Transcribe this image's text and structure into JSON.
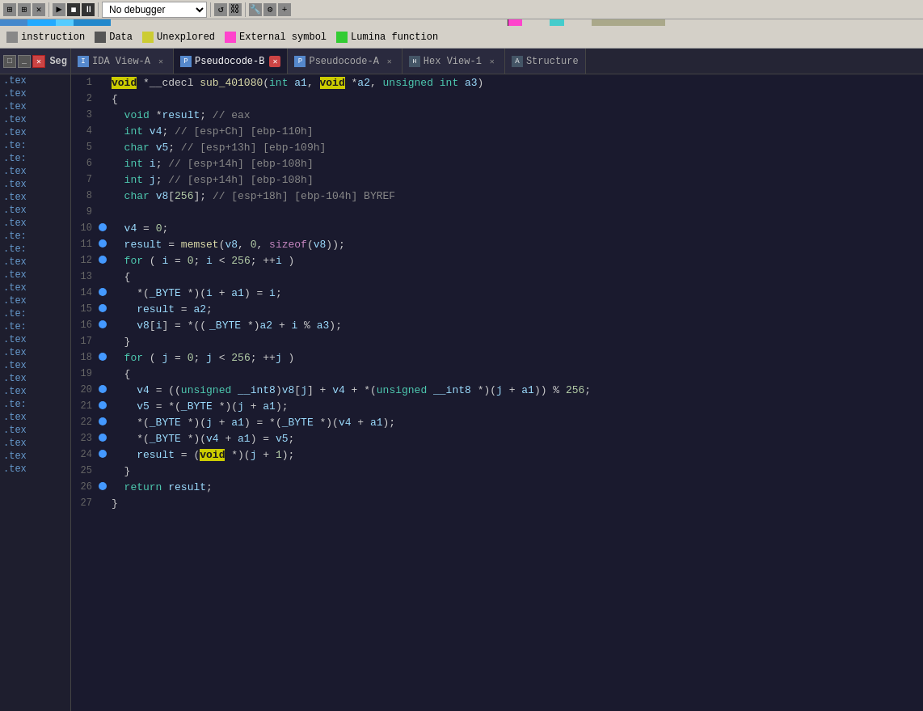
{
  "toolbar": {
    "debugger_label": "No debugger",
    "icons": [
      "grid",
      "grid",
      "cross",
      "play",
      "stop",
      "pause",
      "cursor",
      "cursor2",
      "link",
      "chain",
      "settings",
      "settings2",
      "plus"
    ]
  },
  "colorbar": {
    "segments": [
      {
        "color": "#4488cc",
        "width": "3%"
      },
      {
        "color": "#22aaff",
        "width": "3%"
      },
      {
        "color": "#55ccff",
        "width": "2%"
      },
      {
        "color": "#2288cc",
        "width": "4%"
      },
      {
        "color": "#d4d0c8",
        "width": "45%"
      },
      {
        "color": "#ff44cc",
        "width": "1%"
      },
      {
        "color": "#d4d0c8",
        "width": "3%"
      },
      {
        "color": "#44cccc",
        "width": "1%"
      },
      {
        "color": "#d4d0c8",
        "width": "3%"
      },
      {
        "color": "#aaa88a",
        "width": "6%"
      },
      {
        "color": "#d4d0c8",
        "width": "29%"
      }
    ]
  },
  "legend": {
    "items": [
      {
        "label": "instruction",
        "color": "#aaaaaa"
      },
      {
        "label": "Data",
        "color": "#555555"
      },
      {
        "label": "Unexplored",
        "color": "#cccc33"
      },
      {
        "label": "External symbol",
        "color": "#ff44cc"
      },
      {
        "label": "Lumina function",
        "color": "#33cc33"
      }
    ]
  },
  "sidebar": {
    "title": "Seg",
    "items": [
      ".tex",
      ".tex",
      ".tex",
      ".tex",
      ".tex",
      ".te:",
      ".te:",
      ".tex",
      ".tex",
      ".tex",
      ".tex",
      ".tex",
      ".te:",
      ".te:",
      ".tex",
      ".tex",
      ".tex",
      ".tex",
      ".te:",
      ".te:",
      ".tex",
      ".tex",
      ".tex",
      ".tex",
      ".tex",
      ".te:",
      ".tex",
      ".tex",
      ".tex",
      ".tex",
      ".tex"
    ]
  },
  "tabs": [
    {
      "label": "IDA View-A",
      "active": false,
      "closable": true,
      "icon": "ida"
    },
    {
      "label": "Pseudocode-B",
      "active": true,
      "closable": true,
      "icon": "pseudo",
      "has_x": true
    },
    {
      "label": "Pseudocode-A",
      "active": false,
      "closable": true,
      "icon": "pseudo"
    },
    {
      "label": "Hex View-1",
      "active": false,
      "closable": true,
      "icon": "hex"
    },
    {
      "label": "Structure",
      "active": false,
      "closable": false,
      "icon": "struct"
    }
  ],
  "code": {
    "function_signature": "void *__cdecl sub_401080(int a1, void *a2, unsigned int a3)",
    "lines": [
      {
        "num": 1,
        "bp": false,
        "content": "void *__cdecl sub_401080(int a1, void *a2, unsigned int a3)"
      },
      {
        "num": 2,
        "bp": false,
        "content": "{"
      },
      {
        "num": 3,
        "bp": false,
        "content": "  void *result; // eax"
      },
      {
        "num": 4,
        "bp": false,
        "content": "  int v4; // [esp+Ch] [ebp-110h]"
      },
      {
        "num": 5,
        "bp": false,
        "content": "  char v5; // [esp+13h] [ebp-109h]"
      },
      {
        "num": 6,
        "bp": false,
        "content": "  int i; // [esp+14h] [ebp-108h]"
      },
      {
        "num": 7,
        "bp": false,
        "content": "  int j; // [esp+14h] [ebp-108h]"
      },
      {
        "num": 8,
        "bp": false,
        "content": "  char v8[256]; // [esp+18h] [ebp-104h] BYREF"
      },
      {
        "num": 9,
        "bp": false,
        "content": ""
      },
      {
        "num": 10,
        "bp": true,
        "content": "  v4 = 0;"
      },
      {
        "num": 11,
        "bp": true,
        "content": "  result = memset(v8, 0, sizeof(v8));"
      },
      {
        "num": 12,
        "bp": true,
        "content": "  for ( i = 0; i < 256; ++i )"
      },
      {
        "num": 13,
        "bp": false,
        "content": "  {"
      },
      {
        "num": 14,
        "bp": true,
        "content": "    *(_BYTE *)(i + a1) = i;"
      },
      {
        "num": 15,
        "bp": true,
        "content": "    result = a2;"
      },
      {
        "num": 16,
        "bp": true,
        "content": "    v8[i] = *((_BYTE *)a2 + i % a3);"
      },
      {
        "num": 17,
        "bp": false,
        "content": "  }"
      },
      {
        "num": 18,
        "bp": true,
        "content": "  for ( j = 0; j < 256; ++j )"
      },
      {
        "num": 19,
        "bp": false,
        "content": "  {"
      },
      {
        "num": 20,
        "bp": true,
        "content": "    v4 = ((unsigned __int8)v8[j] + v4 + *(unsigned __int8 *)(j + a1)) % 256;"
      },
      {
        "num": 21,
        "bp": true,
        "content": "    v5 = *(_BYTE *)(j + a1);"
      },
      {
        "num": 22,
        "bp": true,
        "content": "    *(_BYTE *)(j + a1) = *(_BYTE *)(v4 + a1);"
      },
      {
        "num": 23,
        "bp": true,
        "content": "    *(_BYTE *)(v4 + a1) = v5;"
      },
      {
        "num": 24,
        "bp": true,
        "content": "    result = (void *)(j + 1);"
      },
      {
        "num": 25,
        "bp": false,
        "content": "  }"
      },
      {
        "num": 26,
        "bp": true,
        "content": "  return result;"
      },
      {
        "num": 27,
        "bp": false,
        "content": "}"
      }
    ]
  }
}
